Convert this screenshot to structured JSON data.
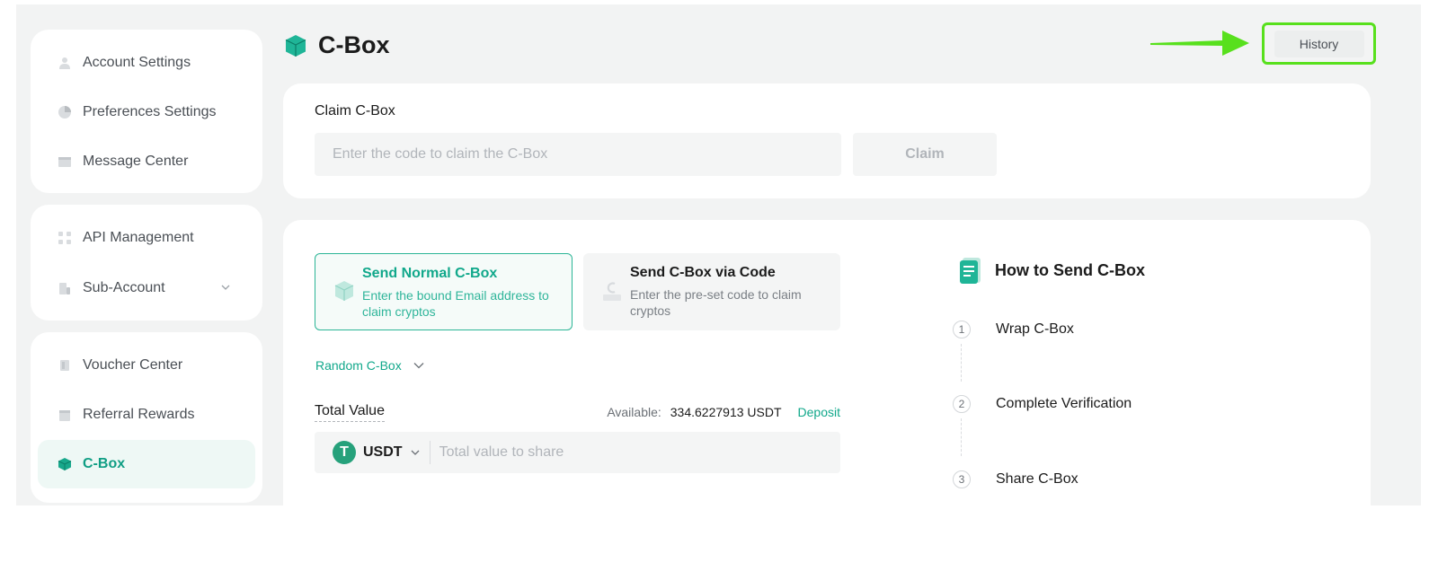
{
  "sidebar": {
    "groups": [
      {
        "items": [
          {
            "label": "Account Settings",
            "icon": "user-icon"
          },
          {
            "label": "Preferences Settings",
            "icon": "pie-chart-icon"
          },
          {
            "label": "Message Center",
            "icon": "message-icon"
          }
        ]
      },
      {
        "items": [
          {
            "label": "API Management",
            "icon": "api-icon"
          },
          {
            "label": "Sub-Account",
            "icon": "sub-account-icon"
          }
        ]
      },
      {
        "items": [
          {
            "label": "Voucher Center",
            "icon": "voucher-icon"
          },
          {
            "label": "Referral Rewards",
            "icon": "gift-icon"
          },
          {
            "label": "C-Box",
            "icon": "cbox-icon",
            "active": true
          }
        ]
      }
    ]
  },
  "header": {
    "title": "C-Box",
    "history_label": "History"
  },
  "claim": {
    "label": "Claim C-Box",
    "placeholder": "Enter the code to claim the C-Box",
    "button_label": "Claim"
  },
  "send": {
    "options": [
      {
        "title": "Send Normal C-Box",
        "desc": "Enter the bound Email address to claim cryptos",
        "selected": true
      },
      {
        "title": "Send C-Box via Code",
        "desc": "Enter the pre-set code to claim cryptos",
        "selected": false
      }
    ],
    "type_select": "Random C-Box",
    "total_value_label": "Total Value",
    "available_label": "Available:",
    "available_value": "334.6227913 USDT",
    "deposit_label": "Deposit",
    "coin": {
      "symbol": "T",
      "name": "USDT"
    },
    "value_placeholder": "Total value to share"
  },
  "howto": {
    "title": "How to Send C-Box",
    "steps": [
      {
        "num": "1",
        "label": "Wrap C-Box"
      },
      {
        "num": "2",
        "label": "Complete Verification"
      },
      {
        "num": "3",
        "label": "Share C-Box"
      }
    ]
  },
  "colors": {
    "accent": "#11a88b",
    "highlight": "#58e01d",
    "panel_bg": "#f2f3f3"
  }
}
